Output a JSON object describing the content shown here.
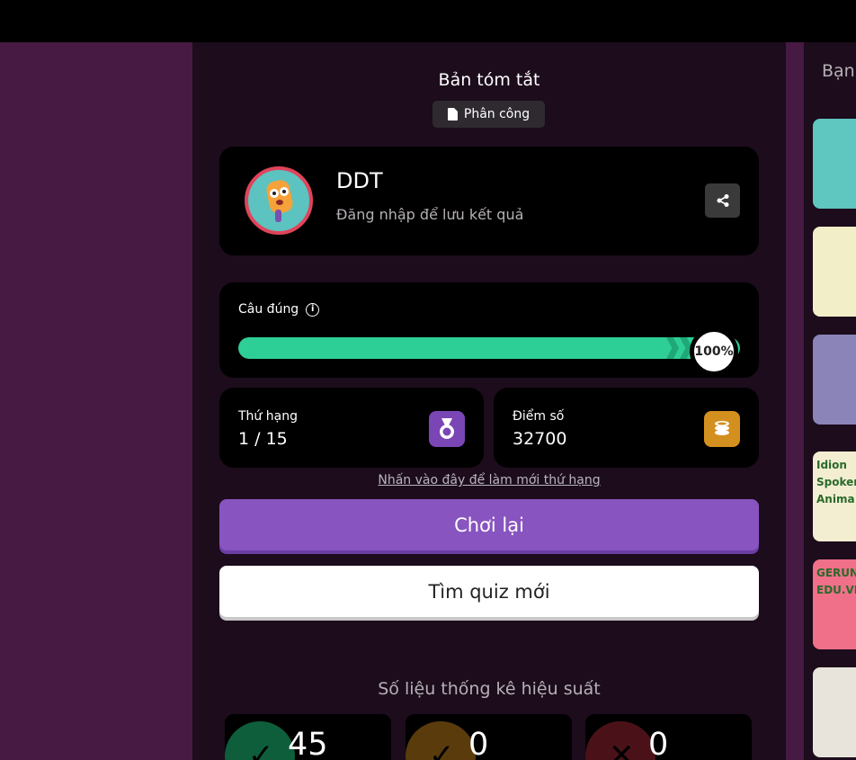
{
  "summary": {
    "title": "Bản tóm tắt",
    "assign_label": "Phân công"
  },
  "profile": {
    "name": "DDT",
    "subtitle": "Đăng nhập để lưu kết quả"
  },
  "accuracy": {
    "label": "Câu đúng",
    "percent_text": "100%",
    "percent": 100
  },
  "rank": {
    "label": "Thứ hạng",
    "value": "1 / 15"
  },
  "score": {
    "label": "Điểm số",
    "value": "32700"
  },
  "refresh_link": "Nhấn vào đây để làm mới thứ hạng",
  "buttons": {
    "replay": "Chơi lại",
    "new_quiz": "Tìm quiz mới"
  },
  "performance": {
    "title": "Số liệu thống kê hiệu suất",
    "cards": [
      {
        "value": "45",
        "color": "#0e5e3c"
      },
      {
        "value": "0",
        "color": "#5a3c0c"
      },
      {
        "value": "0",
        "color": "#4a1218"
      }
    ]
  },
  "right_panel": {
    "label": "Bạn",
    "thumbnails": [
      {
        "name": "zebra-thumbnail",
        "color": "#5fc6c0"
      },
      {
        "name": "dinosaur-thumbnail",
        "color": "#f2efc8"
      },
      {
        "name": "lavender-thumbnail",
        "color": "#8a84b8"
      },
      {
        "name": "idioms-thumbnail",
        "text": "Idion Spoken Anima",
        "color": "#f3eed2"
      },
      {
        "name": "gerunds-thumbnail",
        "text": "GERUNDS EDU.VN",
        "color": "#f0708a"
      },
      {
        "name": "meme-thumbnail",
        "color": "#e8e4dc"
      }
    ]
  },
  "colors": {
    "progress": "#2ecf96",
    "replay_button": "#8854c0",
    "medal": "#7a45b5",
    "coin": "#d4901e"
  }
}
